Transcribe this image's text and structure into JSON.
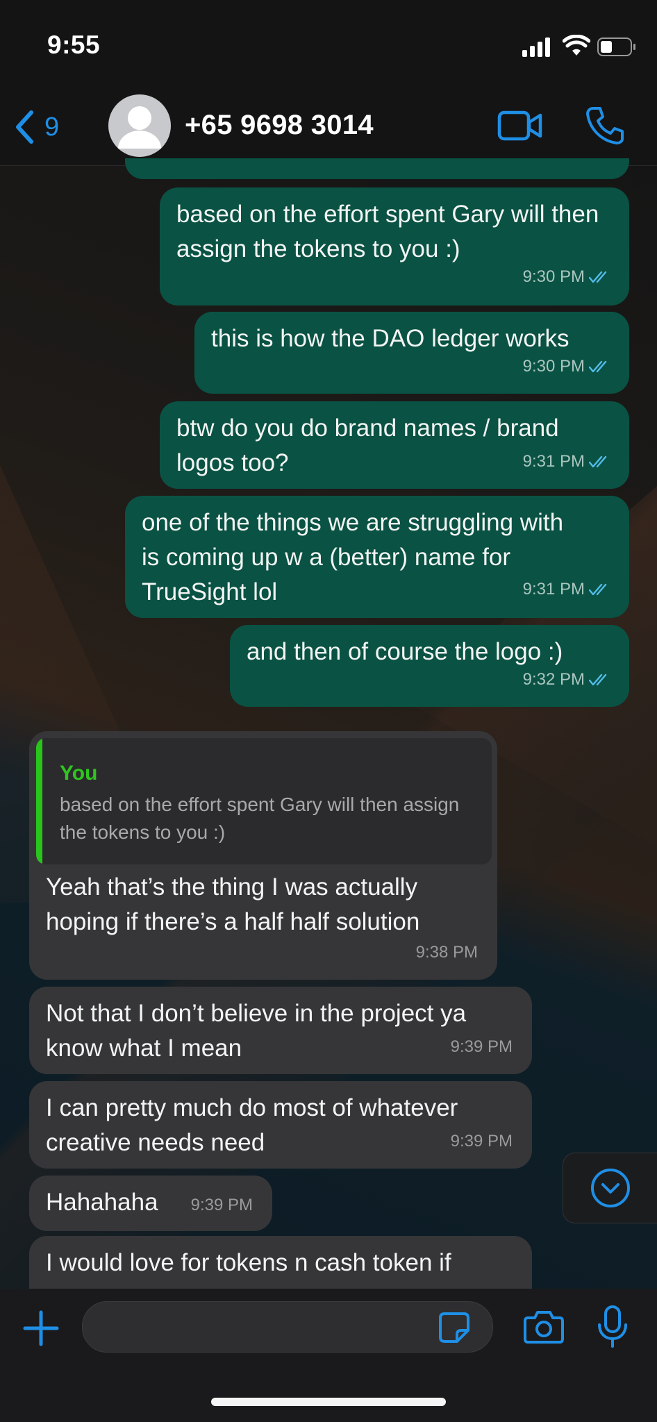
{
  "status_bar": {
    "time": "9:55"
  },
  "header": {
    "back_count": "9",
    "contact": "+65 9698 3014"
  },
  "messages": [
    {
      "direction": "out",
      "text": "based on the effort spent Gary will then assign the tokens to you :)",
      "time": "9:30 PM"
    },
    {
      "direction": "out",
      "text": "this is how the DAO ledger works",
      "time": "9:30 PM"
    },
    {
      "direction": "out",
      "text": "btw do you do brand names / brand logos too?",
      "time": "9:31 PM"
    },
    {
      "direction": "out",
      "text": "one of the things we are struggling with is coming up w a (better) name for TrueSight lol",
      "time": "9:31 PM"
    },
    {
      "direction": "out",
      "text": "and then of course the logo :)",
      "time": "9:32 PM"
    },
    {
      "direction": "in",
      "quote_author": "You",
      "quote_text": "based on the effort spent Gary will then assign the tokens to you :)",
      "text": "Yeah that’s the thing I was actually hoping if there’s a half half solution",
      "time": "9:38 PM"
    },
    {
      "direction": "in",
      "text": "Not that I don’t believe in the project ya know what I mean",
      "time": "9:39 PM"
    },
    {
      "direction": "in",
      "text": "I can pretty much do most of whatever creative needs need",
      "time": "9:39 PM"
    },
    {
      "direction": "in",
      "text": "Hahahaha",
      "time": "9:39 PM"
    },
    {
      "direction": "in",
      "text": "I would love for tokens n cash token if",
      "time": ""
    }
  ],
  "colors": {
    "outgoing_bubble": "#0a5244",
    "incoming_bubble": "#363638",
    "accent": "#1f8fe6",
    "quote_accent": "#2fc61f"
  },
  "icons": [
    "back-chevron-icon",
    "avatar-icon",
    "video-icon",
    "phone-icon",
    "double-check-icon",
    "scroll-down-icon",
    "plus-icon",
    "sticker-icon",
    "camera-icon",
    "microphone-icon"
  ]
}
